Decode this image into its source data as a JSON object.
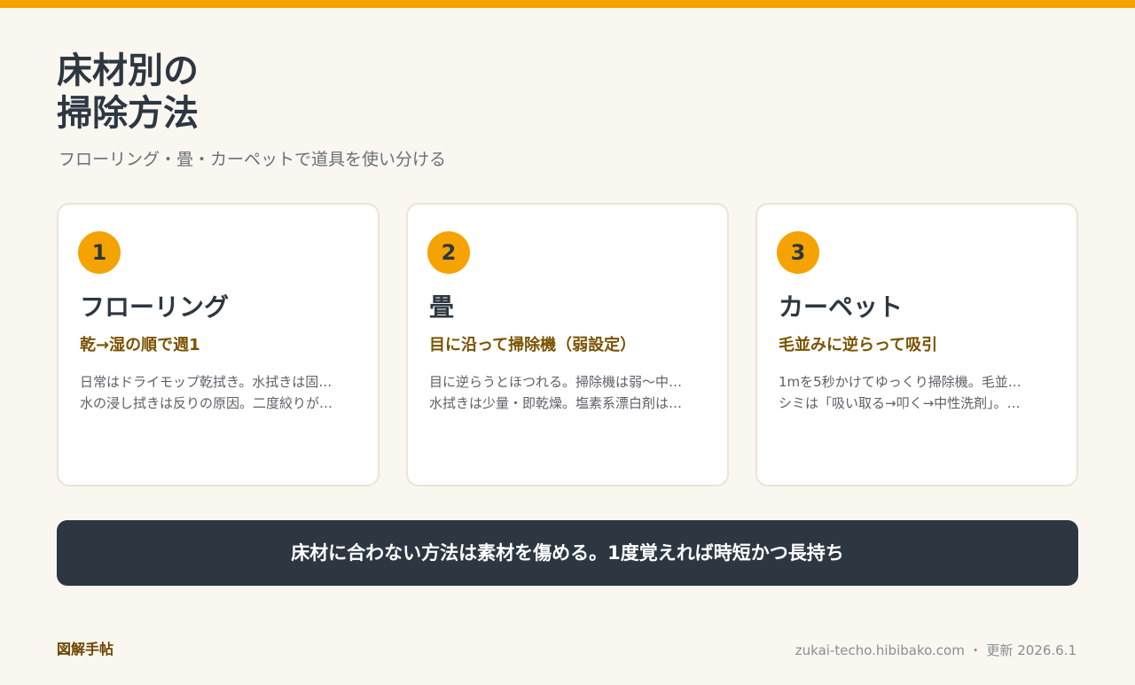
{
  "colors": {
    "accent": "#f5a300",
    "dark": "#2d3742",
    "background": "#faf6f0",
    "subheading": "#7a5300"
  },
  "header": {
    "title_line1": "床材別の",
    "title_line2": "掃除方法",
    "subtitle": "フローリング・畳・カーペットで道具を使い分ける"
  },
  "cards": [
    {
      "number": "1",
      "title": "フローリング",
      "subtitle": "乾→湿の順で週1",
      "lines": [
        "日常はドライモップ乾拭き。水拭きは固…",
        "水の浸し拭きは反りの原因。二度絞りが…"
      ]
    },
    {
      "number": "2",
      "title": "畳",
      "subtitle": "目に沿って掃除機（弱設定）",
      "lines": [
        "目に逆らうとほつれる。掃除機は弱〜中…",
        "水拭きは少量・即乾燥。塩素系漂白剤は…"
      ]
    },
    {
      "number": "3",
      "title": "カーペット",
      "subtitle": "毛並みに逆らって吸引",
      "lines": [
        "1mを5秒かけてゆっくり掃除機。毛並…",
        "シミは「吸い取る→叩く→中性洗剤」。…"
      ]
    }
  ],
  "banner": {
    "text": "床材に合わない方法は素材を傷める。1度覚えれば時短かつ長持ち"
  },
  "footer": {
    "brand": "図解手帖",
    "site": "zukai-techo.hibibako.com",
    "separator": "・",
    "updated": "更新 2026.6.1"
  }
}
